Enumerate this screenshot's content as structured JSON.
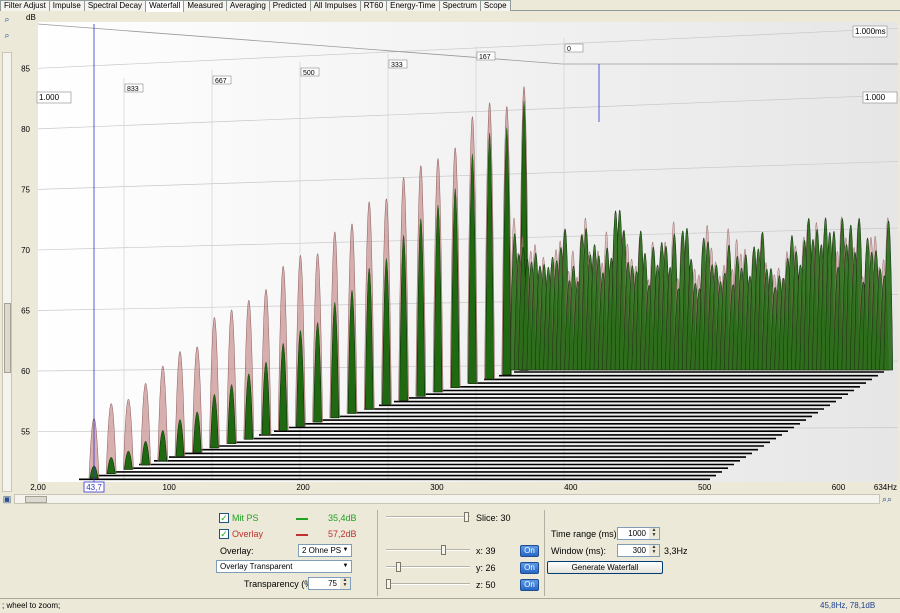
{
  "tabs": [
    "Filter Adjust",
    "Impulse",
    "Spectral Decay",
    "Waterfall",
    "Measured",
    "Averaging",
    "Predicted",
    "All Impulses",
    "RT60",
    "Energy-Time",
    "Spectrum",
    "Scope"
  ],
  "active_tab": "Waterfall",
  "chart": {
    "y_unit": "dB",
    "y_ticks": [
      "85",
      "80",
      "75",
      "70",
      "65",
      "60",
      "55"
    ],
    "x_ticks": [
      "2,00",
      "100",
      "200",
      "300",
      "400",
      "500",
      "600"
    ],
    "x_end_label": "634Hz",
    "cursor_value": "43,7",
    "time_axis_label": "1.000ms",
    "time_ticks": [
      "833",
      "667",
      "500",
      "333",
      "167",
      "0"
    ],
    "left_scale_label": "1.000",
    "right_scale_label": "1.000",
    "series_colors": {
      "overlay": "#c98e8e",
      "main": "#1f6a10"
    }
  },
  "chart_data": {
    "type": "area",
    "title": "",
    "xlabel": "",
    "ylabel": "dB",
    "xlim": [
      2,
      634
    ],
    "ylim": [
      51,
      88
    ],
    "time_range_ms": [
      0,
      1000
    ],
    "series": [
      {
        "name": "Mit PS",
        "peak_level_db": 35.4
      },
      {
        "name": "Overlay",
        "peak_level_db": 57.2
      }
    ]
  },
  "controls": {
    "series": [
      {
        "label": "Mit PS",
        "checked": true,
        "value": "35,4dB",
        "color": "#21a121"
      },
      {
        "label": "Overlay",
        "checked": true,
        "value": "57,2dB",
        "color": "#c03030"
      }
    ],
    "overlay_label": "Overlay:",
    "overlay_select": "2 Ohne PS",
    "overlay_mode": "Overlay Transparent",
    "transparency_label": "Transparency (%)",
    "transparency_value": "75",
    "slice_label": "Slice: 30",
    "x_label": "x: 39",
    "y_label": "y: 26",
    "z_label": "z: 50",
    "on_label": "On",
    "time_range_label": "Time range (ms):",
    "time_range_value": "1000",
    "window_label": "Window (ms):",
    "window_value": "300",
    "window_freq": "3,3Hz",
    "generate_label": "Generate Waterfall"
  },
  "status": {
    "hint": "; wheel to zoom;",
    "readout": "45,8Hz,  78,1dB"
  }
}
